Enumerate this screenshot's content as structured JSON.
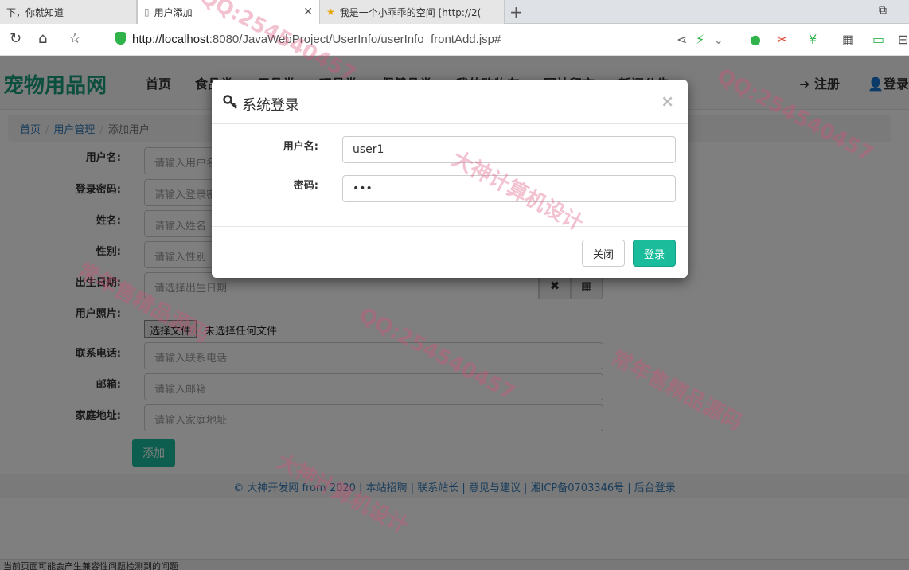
{
  "browser": {
    "tabs": [
      {
        "label": "下，你就知道",
        "active": false
      },
      {
        "label": "用户添加",
        "active": true
      },
      {
        "label": "我是一个小乖乖的空间 [http://2(",
        "active": false
      }
    ],
    "url_host": "http://localhost",
    "url_path": ":8080/JavaWebProject/UserInfo/userInfo_frontAdd.jsp#"
  },
  "site": {
    "brand": "宠物用品网",
    "nav": [
      "首页",
      "食品类",
      "用品类",
      "玩具类",
      "保健品类",
      "我的购物车",
      "网站留言",
      "新闻公告"
    ],
    "nav_right": {
      "register": "注册",
      "login": "登录"
    },
    "breadcrumb": {
      "home": "首页",
      "section": "用户管理",
      "current": "添加用户"
    }
  },
  "form": {
    "fields": [
      {
        "label": "用户名:",
        "placeholder": "请输入用户名"
      },
      {
        "label": "登录密码:",
        "placeholder": "请输入登录密码"
      },
      {
        "label": "姓名:",
        "placeholder": "请输入姓名"
      },
      {
        "label": "性别:",
        "placeholder": "请输入性别"
      },
      {
        "label": "出生日期:",
        "placeholder": "请选择出生日期"
      },
      {
        "label": "用户照片:"
      },
      {
        "label": "联系电话:",
        "placeholder": "请输入联系电话"
      },
      {
        "label": "邮箱:",
        "placeholder": "请输入邮箱"
      },
      {
        "label": "家庭地址:",
        "placeholder": "请输入家庭地址"
      }
    ],
    "file_button": "选择文件",
    "file_none": "未选择任何文件",
    "submit": "添加"
  },
  "footer": "© 大神开发网 from 2020 | 本站招聘 | 联系站长 | 意见与建议 | 湘ICP备0703346号 | 后台登录",
  "statusbar": "当前页面可能会产生兼容性问题检测到的问题",
  "modal": {
    "title": "系统登录",
    "username_label": "用户名:",
    "username_value": "user1",
    "password_label": "密码:",
    "password_value": "•••",
    "close_btn": "关闭",
    "login_btn": "登录"
  },
  "watermark": {
    "qq": "QQ:254540457",
    "slogan1": "大神计算机设计",
    "slogan2": "常年售精品源码"
  }
}
